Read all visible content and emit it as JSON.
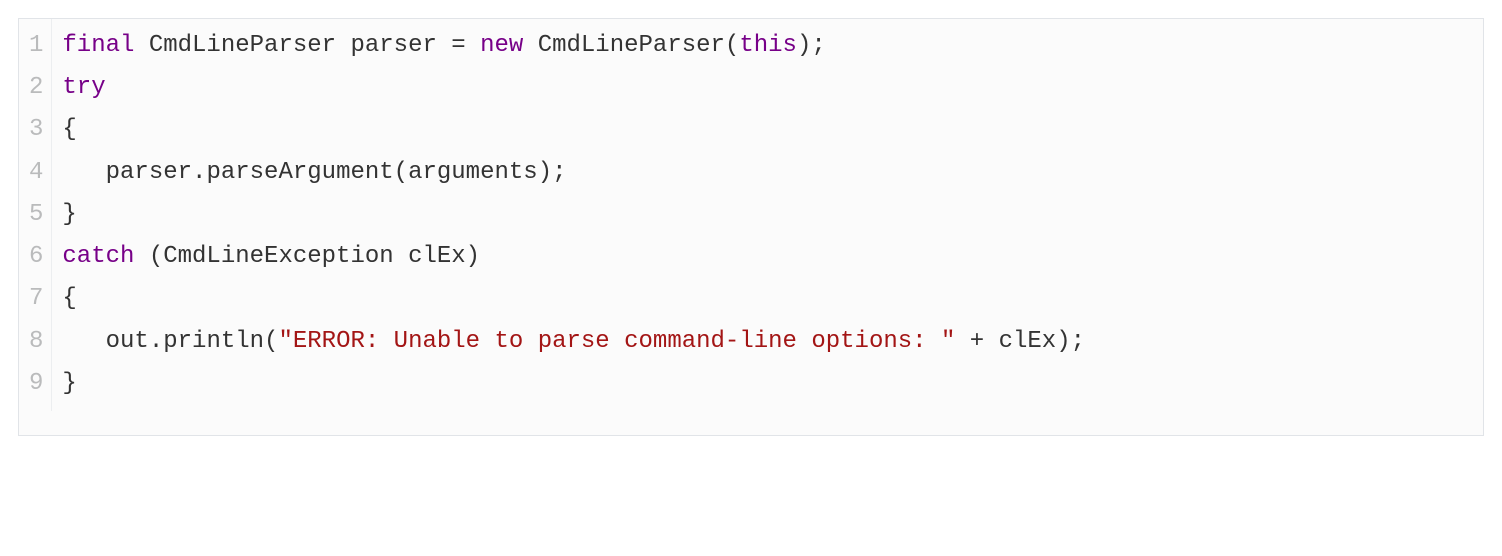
{
  "code": {
    "language": "java",
    "lineNumbers": [
      "1",
      "2",
      "3",
      "4",
      "5",
      "6",
      "7",
      "8",
      "9"
    ],
    "lines": [
      {
        "indent": "",
        "tokens": [
          {
            "cls": "kw",
            "t": "final"
          },
          {
            "cls": "plain",
            "t": " CmdLineParser parser = "
          },
          {
            "cls": "kw",
            "t": "new"
          },
          {
            "cls": "plain",
            "t": " CmdLineParser("
          },
          {
            "cls": "kw",
            "t": "this"
          },
          {
            "cls": "plain",
            "t": ");"
          }
        ]
      },
      {
        "indent": "",
        "tokens": [
          {
            "cls": "kw",
            "t": "try"
          }
        ]
      },
      {
        "indent": "",
        "tokens": [
          {
            "cls": "plain",
            "t": "{"
          }
        ]
      },
      {
        "indent": "   ",
        "tokens": [
          {
            "cls": "plain",
            "t": "parser.parseArgument(arguments);"
          }
        ]
      },
      {
        "indent": "",
        "tokens": [
          {
            "cls": "plain",
            "t": "}"
          }
        ]
      },
      {
        "indent": "",
        "tokens": [
          {
            "cls": "kw",
            "t": "catch"
          },
          {
            "cls": "plain",
            "t": " (CmdLineException clEx)"
          }
        ]
      },
      {
        "indent": "",
        "tokens": [
          {
            "cls": "plain",
            "t": "{"
          }
        ]
      },
      {
        "indent": "   ",
        "tokens": [
          {
            "cls": "plain",
            "t": "out.println("
          },
          {
            "cls": "str",
            "t": "\"ERROR: Unable to parse command-line options: \""
          },
          {
            "cls": "plain",
            "t": " + clEx);"
          }
        ]
      },
      {
        "indent": "",
        "tokens": [
          {
            "cls": "plain",
            "t": "}"
          }
        ]
      }
    ]
  }
}
